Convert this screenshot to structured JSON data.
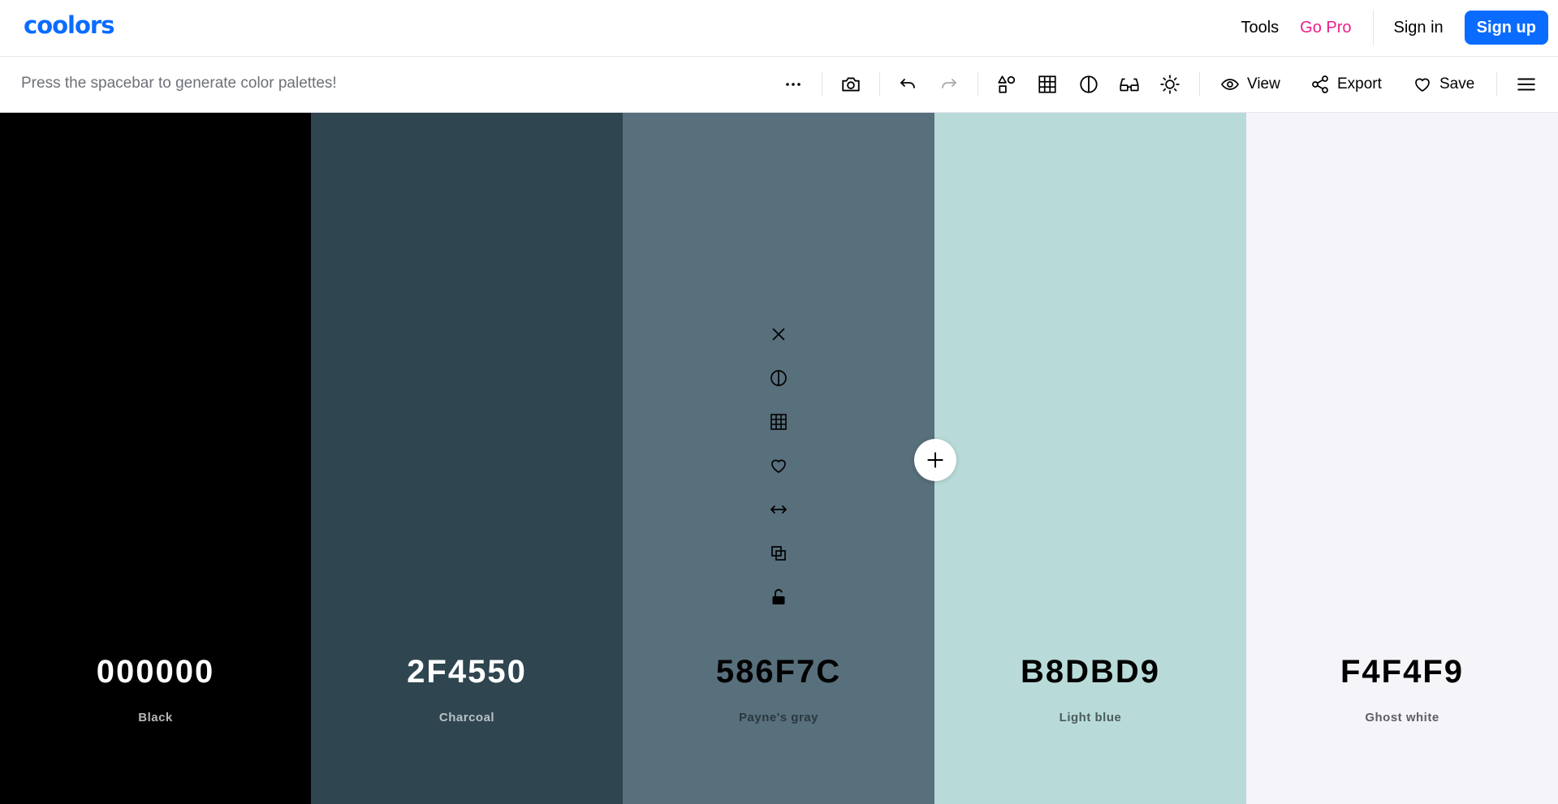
{
  "app": {
    "logo_text": "coolors",
    "brand_color": "#0a6cff"
  },
  "nav": {
    "tools_label": "Tools",
    "go_pro_label": "Go Pro",
    "sign_in_label": "Sign in",
    "sign_up_label": "Sign up",
    "pro_color": "#ee1e8c"
  },
  "toolbar": {
    "hint": "Press the spacebar to generate color palettes!",
    "icons": [
      "more-icon",
      "camera-icon",
      "undo-icon",
      "redo-icon",
      "shapes-icon",
      "grid-icon",
      "contrast-icon",
      "glasses-icon",
      "brightness-icon"
    ],
    "view_label": "View",
    "export_label": "Export",
    "save_label": "Save"
  },
  "palette": {
    "colors": [
      {
        "hex": "000000",
        "name": "Black",
        "bg": "#000000",
        "hex_color": "#ffffff",
        "name_color": "#b7b7b7"
      },
      {
        "hex": "2F4550",
        "name": "Charcoal",
        "bg": "#2f4550",
        "hex_color": "#ffffff",
        "name_color": "#b9c1c5"
      },
      {
        "hex": "586F7C",
        "name": "Payne's gray",
        "bg": "#586f7c",
        "hex_color": "#000000",
        "name_color": "#2b3840"
      },
      {
        "hex": "B8DBD9",
        "name": "Light blue",
        "bg": "#b8dbd9",
        "hex_color": "#000000",
        "name_color": "#4b5b5a"
      },
      {
        "hex": "F4F4F9",
        "name": "Ghost white",
        "bg": "#f4f4f9",
        "hex_color": "#000000",
        "name_color": "#5e5e63"
      }
    ],
    "hovered_index": 2,
    "swatch_tool_icons": [
      "remove-icon",
      "contrast-icon",
      "shades-grid-icon",
      "favorite-heart-icon",
      "drag-arrows-icon",
      "copy-icon",
      "lock-open-icon"
    ]
  }
}
